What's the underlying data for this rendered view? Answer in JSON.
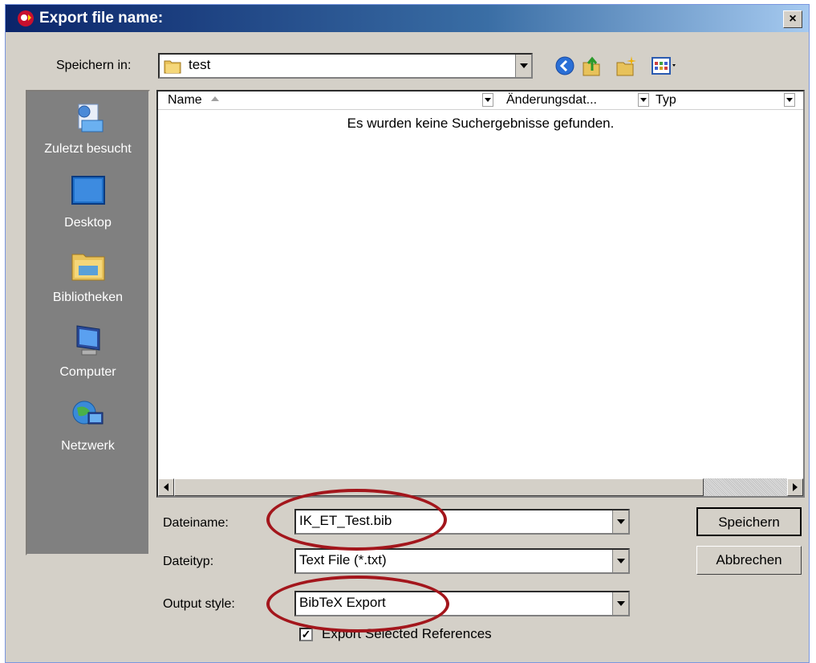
{
  "window": {
    "title": "Export file name:",
    "close_glyph": "×"
  },
  "toolbar": {
    "save_in_label": "Speichern in:",
    "save_in_value": "test",
    "icons": [
      "back-icon",
      "up-folder-icon",
      "new-folder-icon",
      "view-menu-icon"
    ]
  },
  "places": [
    {
      "label": "Zuletzt besucht",
      "icon": "recent-places-icon"
    },
    {
      "label": "Desktop",
      "icon": "desktop-icon"
    },
    {
      "label": "Bibliotheken",
      "icon": "libraries-icon"
    },
    {
      "label": "Computer",
      "icon": "computer-icon"
    },
    {
      "label": "Netzwerk",
      "icon": "network-icon"
    }
  ],
  "file_list": {
    "columns": [
      "Name",
      "Änderungsdat...",
      "Typ"
    ],
    "empty_message": "Es wurden keine Suchergebnisse gefunden."
  },
  "form": {
    "filename_label": "Dateiname:",
    "filename_value": "IK_ET_Test.bib",
    "filetype_label": "Dateityp:",
    "filetype_value": "Text File (*.txt)",
    "output_style_label": "Output style:",
    "output_style_value": "BibTeX Export",
    "export_selected_label": "Export Selected References",
    "export_selected_checked": true
  },
  "buttons": {
    "save": "Speichern",
    "cancel": "Abbrechen"
  },
  "colors": {
    "annotation": "#a3161c",
    "places_bg": "#808080",
    "dialog_bg": "#d4d0c8"
  }
}
